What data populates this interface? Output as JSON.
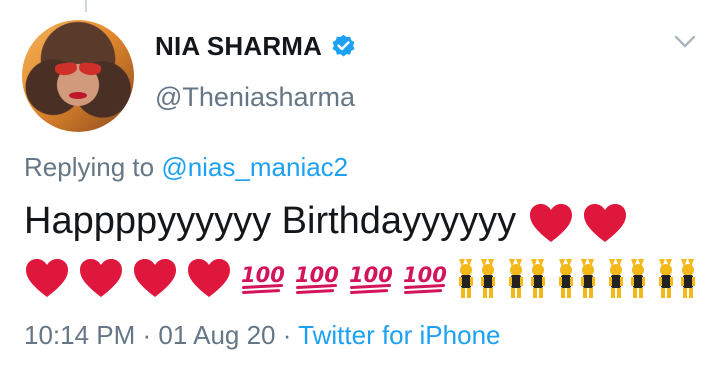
{
  "author": {
    "display_name": "NIA SHARMA",
    "handle": "@Theniasharma",
    "verified": true
  },
  "reply": {
    "prefix": "Replying to ",
    "mention": "@nias_maniac2"
  },
  "tweet": {
    "text": "Happppyyyyyy Birthdayyyyyy",
    "emoji_sequence": [
      "red-heart",
      "red-heart",
      "red-heart",
      "red-heart",
      "red-heart",
      "red-heart",
      "hundred-points",
      "hundred-points",
      "hundred-points",
      "hundred-points",
      "people-with-bunny-ears",
      "people-with-bunny-ears",
      "people-with-bunny-ears",
      "people-with-bunny-ears",
      "people-with-bunny-ears",
      "people-with-bunny-ears",
      "people-with-bunny-ears"
    ]
  },
  "meta": {
    "time": "10:14 PM",
    "separator": " · ",
    "date": "01 Aug 20",
    "source": "Twitter for iPhone"
  },
  "colors": {
    "accent": "#1da1f2",
    "muted": "#657786",
    "heart": "#e0173c",
    "hundred": "#d4145a",
    "dancer_skin": "#f5b81b"
  }
}
